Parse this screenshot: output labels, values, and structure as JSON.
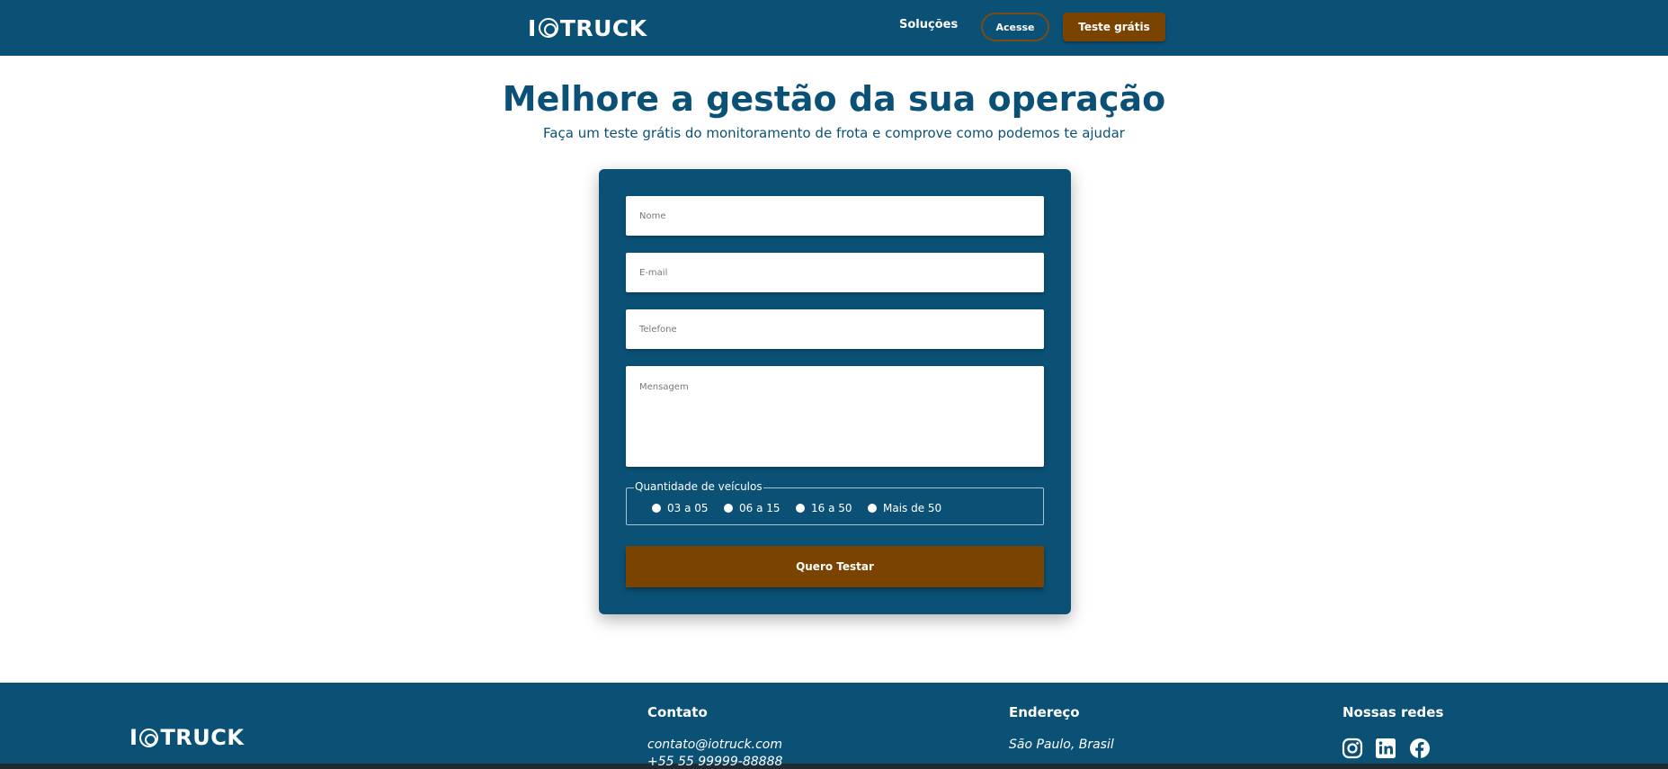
{
  "header": {
    "logo_left": "I",
    "logo_right": "TRUCK",
    "nav_solucoes": "Soluções",
    "btn_acesse": "Acesse",
    "btn_trial": "Teste grátis"
  },
  "hero": {
    "title": "Melhore a gestão da sua operação",
    "subtitle": "Faça um teste grátis do monitoramento de frota e comprove como podemos te ajudar"
  },
  "form": {
    "nome_placeholder": "Nome",
    "email_placeholder": "E-mail",
    "telefone_placeholder": "Telefone",
    "mensagem_placeholder": "Mensagem",
    "fleet_legend": "Quantidade de veículos",
    "options": [
      "03 a 05",
      "06 a 15",
      "16 a 50",
      "Mais de 50"
    ],
    "submit_label": "Quero Testar"
  },
  "footer": {
    "logo_left": "I",
    "logo_right": "TRUCK",
    "contato_title": "Contato",
    "contato_email": "contato@iotruck.com",
    "contato_phone": "+55 55 99999-88888",
    "endereco_title": "Endereço",
    "endereco_text": "São Paulo, Brasil",
    "redes_title": "Nossas redes"
  },
  "colors": {
    "primary": "#0b5176",
    "accent": "#7a4300",
    "white": "#ffffff"
  },
  "icons": [
    "wheel-logo-icon",
    "instagram-icon",
    "linkedin-icon",
    "facebook-icon",
    "radio-icon"
  ]
}
